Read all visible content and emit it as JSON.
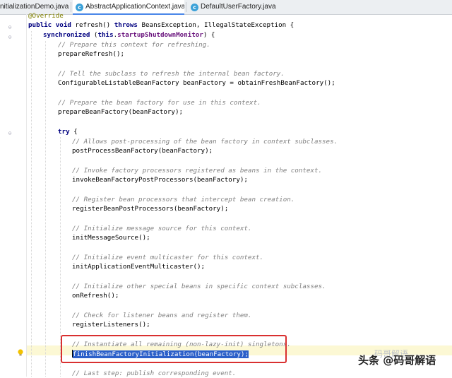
{
  "tabs": [
    {
      "label": "nitializationDemo.java"
    },
    {
      "label": "AbstractApplicationContext.java",
      "active": true
    },
    {
      "label": "DefaultUserFactory.java"
    }
  ],
  "tab_close": "×",
  "tab_class_glyph": "c",
  "code": {
    "annotation": "@Override",
    "l_sig_a": "public",
    "l_sig_b": "void",
    "l_sig_c": " refresh() ",
    "l_sig_d": "throws",
    "l_sig_e": " BeansException, IllegalStateException {",
    "l_sync_a": "synchronized",
    "l_sync_b": " (",
    "l_sync_c": "this",
    "l_sync_d": ".",
    "l_sync_e": "startupShutdownMonitor",
    "l_sync_f": ") {",
    "c1": "// Prepare this context for refreshing.",
    "s1": "prepareRefresh();",
    "c2": "// Tell the subclass to refresh the internal bean factory.",
    "s2": "ConfigurableListableBeanFactory beanFactory = obtainFreshBeanFactory();",
    "c3": "// Prepare the bean factory for use in this context.",
    "s3": "prepareBeanFactory(beanFactory);",
    "try_kw": "try",
    "try_brace": " {",
    "c4": "// Allows post-processing of the bean factory in context subclasses.",
    "s4": "postProcessBeanFactory(beanFactory);",
    "c5": "// Invoke factory processors registered as beans in the context.",
    "s5": "invokeBeanFactoryPostProcessors(beanFactory);",
    "c6": "// Register bean processors that intercept bean creation.",
    "s6": "registerBeanPostProcessors(beanFactory);",
    "c7": "// Initialize message source for this context.",
    "s7": "initMessageSource();",
    "c8": "// Initialize event multicaster for this context.",
    "s8": "initApplicationEventMulticaster();",
    "c9": "// Initialize other special beans in specific context subclasses.",
    "s9": "onRefresh();",
    "c10": "// Check for listener beans and register them.",
    "s10": "registerListeners();",
    "c11": "// Instantiate all remaining (non-lazy-init) singletons.",
    "s11": "finishBeanFactoryInitialization(beanFactory);",
    "c12": "// Last step: publish corresponding event."
  },
  "watermark": "头条 @码哥解语",
  "watermark_faint": "码哥解语",
  "colors": {
    "keyword": "#000080",
    "comment": "#808080",
    "annotation": "#808000",
    "field": "#660e7a",
    "selection": "#2b5fc9",
    "highlight_box": "#d93030"
  },
  "icons": [
    "class-icon",
    "lightbulb-icon",
    "fold-icon"
  ]
}
